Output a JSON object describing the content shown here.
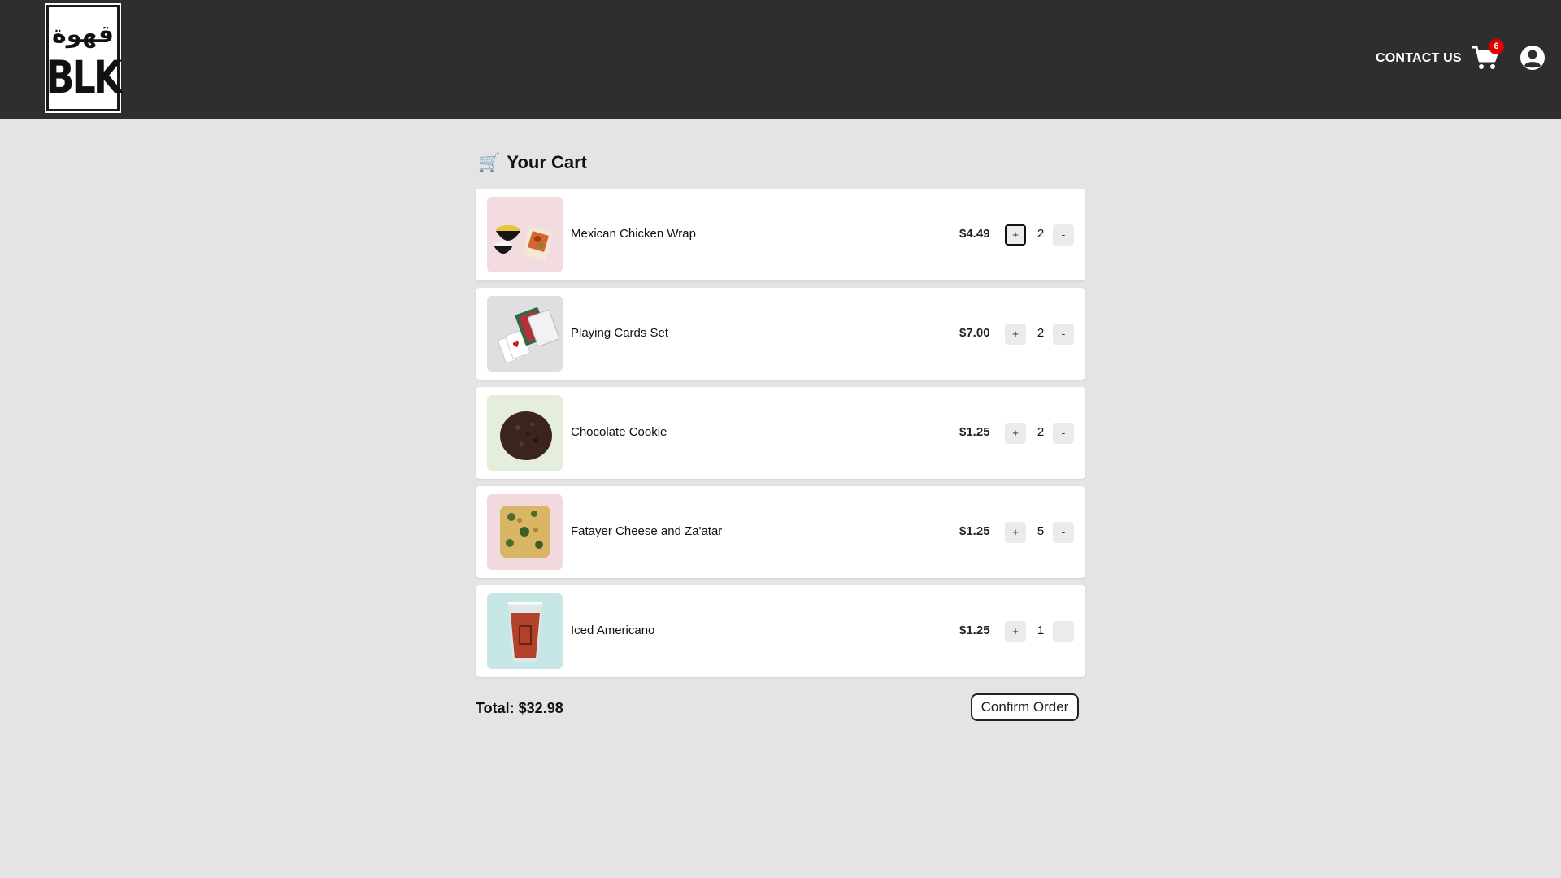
{
  "header": {
    "logo_arabic": "قهوة",
    "logo_latin": "BLK",
    "contact_label": "CONTACT US",
    "cart_count": "6",
    "cart_icon": "shopping-cart-icon",
    "account_icon": "user-circle-icon"
  },
  "cart": {
    "title_icon": "🛒",
    "title": "Your Cart",
    "items": [
      {
        "name": "Mexican Chicken Wrap",
        "price": "$4.49",
        "plus": "+",
        "qty": "2",
        "minus": "-",
        "image_bg": "#f3dcdf"
      },
      {
        "name": "Playing Cards Set",
        "price": "$7.00",
        "plus": "+",
        "qty": "2",
        "minus": "-",
        "image_bg": "#dddfe0"
      },
      {
        "name": "Chocolate Cookie",
        "price": "$1.25",
        "plus": "+",
        "qty": "2",
        "minus": "-",
        "image_bg": "#e4eedb"
      },
      {
        "name": "Fatayer Cheese and Za'atar",
        "price": "$1.25",
        "plus": "+",
        "qty": "5",
        "minus": "-",
        "image_bg": "#f2d9dd"
      },
      {
        "name": "Iced Americano",
        "price": "$1.25",
        "plus": "+",
        "qty": "1",
        "minus": "-",
        "image_bg": "#c7e6e6"
      }
    ],
    "total": "Total: $32.98",
    "confirm_label": "Confirm Order"
  },
  "colors": {
    "header_bg": "#2e2e2e",
    "page_bg": "#e4e4e4",
    "badge": "#e00000"
  }
}
